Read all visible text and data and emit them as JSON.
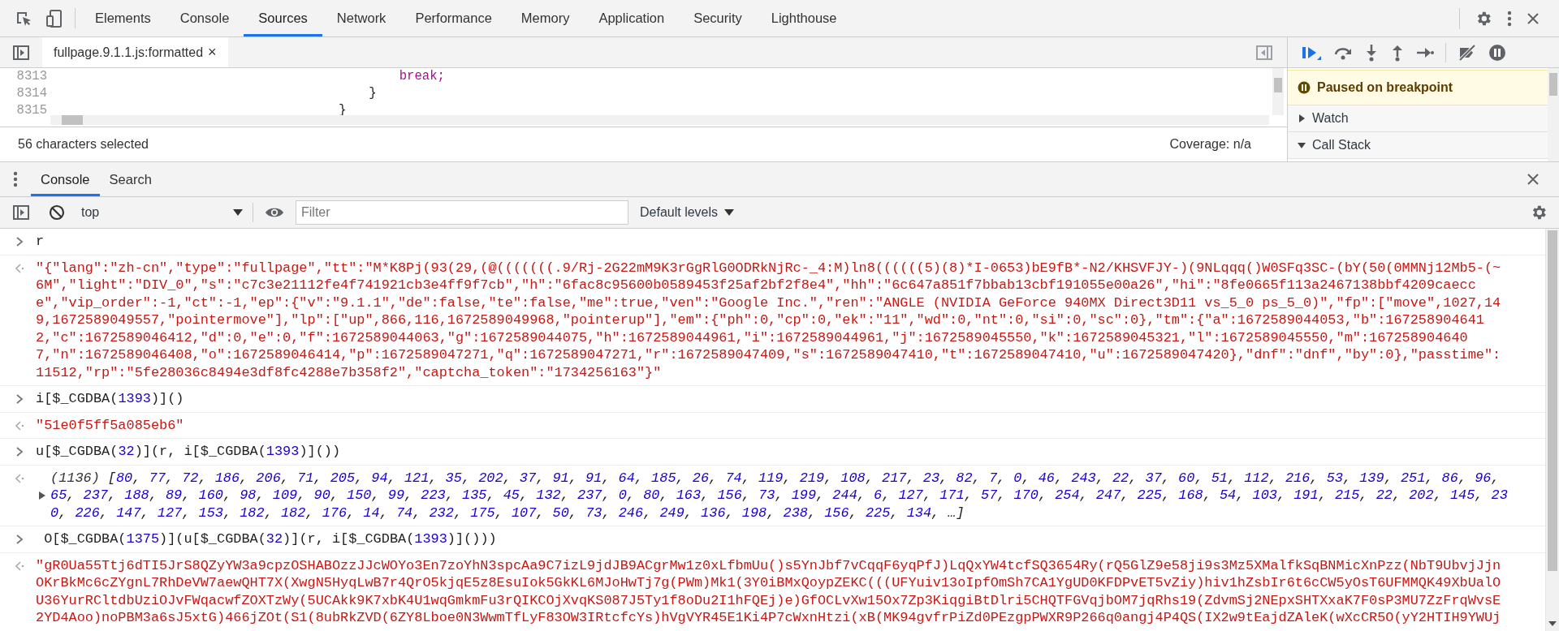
{
  "panel_tabs": [
    {
      "label": "Elements",
      "selected": false
    },
    {
      "label": "Console",
      "selected": false
    },
    {
      "label": "Sources",
      "selected": true
    },
    {
      "label": "Network",
      "selected": false
    },
    {
      "label": "Performance",
      "selected": false
    },
    {
      "label": "Memory",
      "selected": false
    },
    {
      "label": "Application",
      "selected": false
    },
    {
      "label": "Security",
      "selected": false
    },
    {
      "label": "Lighthouse",
      "selected": false
    }
  ],
  "editor": {
    "file_tab": {
      "label": "fullpage.9.1.1.js:formatted",
      "close": "×",
      "selected": true
    },
    "lines": [
      {
        "number": "8313",
        "code": "                                            break;",
        "kind": "keyword"
      },
      {
        "number": "8314",
        "code": "                                        }",
        "kind": "plain"
      },
      {
        "number": "8315",
        "code": "                                    }",
        "kind": "plain"
      }
    ]
  },
  "status_bar": {
    "selection": "56 characters selected",
    "coverage": "Coverage: n/a"
  },
  "debugger": {
    "banner": "Paused on breakpoint",
    "sections": [
      {
        "label": "Watch",
        "expanded": false
      },
      {
        "label": "Call Stack",
        "expanded": true
      }
    ]
  },
  "drawer": {
    "tabs": [
      {
        "label": "Console",
        "selected": true
      },
      {
        "label": "Search",
        "selected": false
      }
    ]
  },
  "console_toolbar": {
    "context": "top",
    "filter_placeholder": "Filter",
    "levels": "Default levels"
  },
  "messages": [
    {
      "kind": "input",
      "text": "r"
    },
    {
      "kind": "string",
      "lines": [
        "\"{\"lang\":\"zh-cn\",\"type\":\"fullpage\",\"tt\":\"M*K8Pj(93(29,(@(((((((.9/Rj-2G22mM9K3rGgRlG0ODRkNjRc-_4:M)ln8((((((5)(8)*I-0653)bE9fB*-N2/KHSVFJY-)(9NLqqq()W0SFq3SC-(bY(50(0MMNj12Mb5-(~",
        "6M\",\"light\":\"DIV_0\",\"s\":\"c7c3e21112fe4f741921cb3e4ff9f7cb\",\"h\":\"6fac8c95600b0589453f25af2bf2f8e4\",\"hh\":\"6c647a851f7bbab13cbf191055e00a26\",\"hi\":\"8fe0665f113a2467138bbf4209caecc",
        "e\",\"vip_order\":-1,\"ct\":-1,\"ep\":{\"v\":\"9.1.1\",\"de\":false,\"te\":false,\"me\":true,\"ven\":\"Google Inc.\",\"ren\":\"ANGLE (NVIDIA GeForce 940MX Direct3D11 vs_5_0 ps_5_0)\",\"fp\":[\"move\",1027,14",
        "9,1672589049557,\"pointermove\"],\"lp\":[\"up\",866,116,1672589049968,\"pointerup\"],\"em\":{\"ph\":0,\"cp\":0,\"ek\":\"11\",\"wd\":0,\"nt\":0,\"si\":0,\"sc\":0},\"tm\":{\"a\":1672589044053,\"b\":167258904641",
        "2,\"c\":1672589046412,\"d\":0,\"e\":0,\"f\":1672589044063,\"g\":1672589044075,\"h\":1672589044961,\"i\":1672589044961,\"j\":1672589045550,\"k\":1672589045321,\"l\":1672589045550,\"m\":167258904640",
        "7,\"n\":1672589046408,\"o\":1672589046414,\"p\":1672589047271,\"q\":1672589047271,\"r\":1672589047409,\"s\":1672589047410,\"t\":1672589047410,\"u\":1672589047420},\"dnf\":\"dnf\",\"by\":0},\"passtime\":",
        "11512,\"rp\":\"5fe28036c8494e3df8fc4288e7b358f2\",\"captcha_token\":\"1734256163\"}\""
      ]
    },
    {
      "kind": "input",
      "text": "i[$_CGDBA(1393)]()"
    },
    {
      "kind": "string",
      "lines": [
        "\"51e0f5ff5a085eb6\""
      ]
    },
    {
      "kind": "input",
      "text": "u[$_CGDBA(32)](r, i[$_CGDBA(1393)]())"
    },
    {
      "kind": "array",
      "length": "(1136)",
      "expanded": false,
      "lines": [
        "[80, 77, 72, 186, 206, 71, 205, 94, 121, 35, 202, 37, 91, 91, 64, 185, 26, 74, 119, 219, 108, 217, 23, 82, 7, 0, 46, 243, 22, 37, 60, 51, 112, 216, 53, 139, 251, 86, 96,",
        "65, 237, 188, 89, 160, 98, 109, 90, 150, 99, 223, 135, 45, 132, 237, 0, 80, 163, 156, 73, 199, 244, 6, 127, 171, 57, 170, 254, 247, 225, 168, 54, 103, 191, 215, 22, 202, 145, 23",
        "0, 226, 147, 127, 153, 182, 182, 176, 14, 74, 232, 175, 107, 50, 73, 246, 249, 136, 198, 238, 156, 225, 134, …]"
      ]
    },
    {
      "kind": "input",
      "text": " O[$_CGDBA(1375)](u[$_CGDBA(32)](r, i[$_CGDBA(1393)]()))"
    },
    {
      "kind": "string",
      "lines": [
        "\"gR0Ua55Ttj6dTI5JrS8QZyYW3a9cpzOSHABOzzJJcWOYo3En7zoYhN3spcAa9C7izL9jdJB9ACgrMw1z0xLfbmUu()s5YnJbf7vCqqF6yqPfJ)LqQxYW4tcfSQ3654Ry(rQ5GlZ9e58ji9s3Mz5XMalfkSqBNMicXnPzz(NbT9UbvjJjn",
        "OKrBkMc6cZYgnL7RhDeVW7aewQHT7X(XwgN5HyqLwB7r4QrO5kjqE5z8EsuIok5GkKL6MJoHwTj7g(PWm)Mk1(3Y0iBMxQoypZEKC(((UFYuiv13oIpfOmSh7CA1YgUD0KFDPvET5vZiy)hiv1hZsbIr6t6cCW5yOsT6UFMMQK49XbUalO",
        "U36YurRCltdbUziOJvFWqacwfZOXTzWy(5UCAkk9K7xbK4U1wqGmkmFu3rQIKCOjXvqKS087J5Ty1f8oDu2I1hFQEj)e)GfOCLvXw15Ox7Zp3KiqgiBtDlri5CHQTFGVqjbOM7jqRhs19(ZdvmSj2NEpxSHTXxaK7F0sP3MU7ZzFrqWvsE",
        "2YD4Aoo)noPBM3a6sJ5xtG)466jZOt(S1(8ubRkZVD(6ZY8Lboe0N3WwmTfLyF83OW3IRtcfcYs)hVgVYR45E1Ki4P7cWxnHtzi(xB(MK94gvfrPiZd0PEzgpPWXR9P266q0angj4P4QS(IX2w9tEajdZAleK(wXcCR5O(yY2HTIH9YWUj"
      ]
    }
  ]
}
